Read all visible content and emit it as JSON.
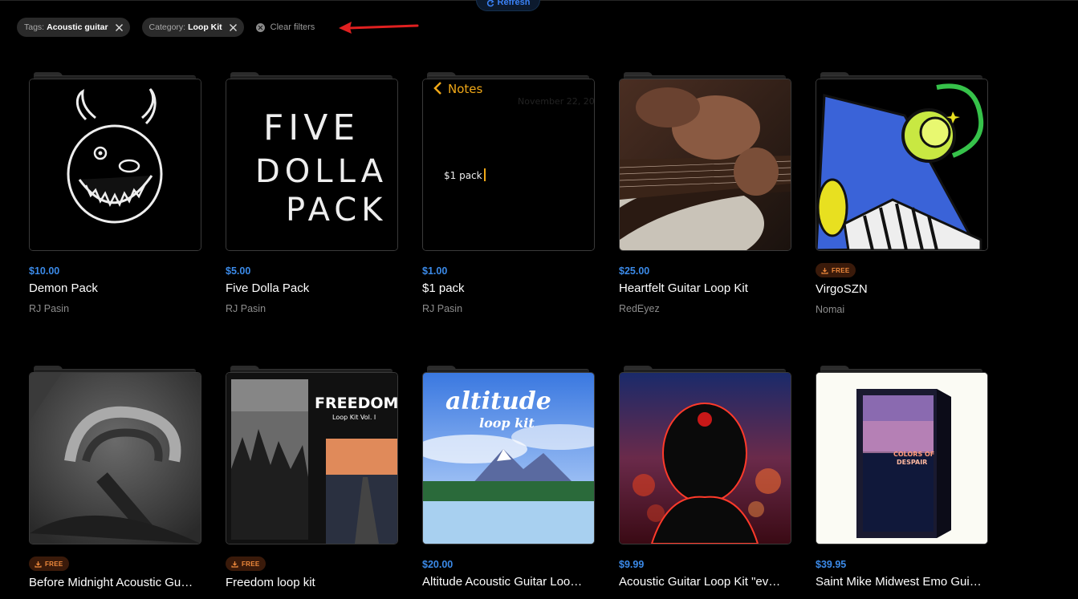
{
  "header": {
    "refresh_label": "Refresh"
  },
  "filters": {
    "chips": [
      {
        "key": "Tags:",
        "value": "Acoustic guitar"
      },
      {
        "key": "Category:",
        "value": "Loop Kit"
      }
    ],
    "clear_label": "Clear filters"
  },
  "products": [
    {
      "price": "$10.00",
      "title": "Demon Pack",
      "author": "RJ Pasin",
      "art": "demon"
    },
    {
      "price": "$5.00",
      "title": "Five Dolla Pack",
      "author": "RJ Pasin",
      "art": "five",
      "art_text": [
        "FIVE",
        "DOLLA",
        "PACK"
      ]
    },
    {
      "price": "$1.00",
      "title": "$1 pack",
      "author": "RJ Pasin",
      "art": "notes",
      "art_text": {
        "back": "Notes",
        "date": "November 22, 20",
        "body": "$1 pack"
      }
    },
    {
      "price": "$25.00",
      "title": "Heartfelt Guitar Loop Kit",
      "author": "RedEyez",
      "art": "guitar"
    },
    {
      "badge": "FREE",
      "title": "VirgoSZN",
      "author": "Nomai",
      "art": "rocket"
    },
    {
      "badge": "FREE",
      "title": "Before Midnight Acoustic Gu…",
      "author": "",
      "art": "gray"
    },
    {
      "badge": "FREE",
      "title": "Freedom loop kit",
      "author": "",
      "art": "freedom",
      "art_text": {
        "title": "FREEDOM",
        "sub": "Loop Kit Vol. I"
      }
    },
    {
      "price": "$20.00",
      "title": "Altitude Acoustic Guitar Loo…",
      "author": "",
      "art": "altitude",
      "art_text": {
        "title": "altitude",
        "sub": "loop kit"
      }
    },
    {
      "price": "$9.99",
      "title": "Acoustic Guitar Loop Kit \"ev…",
      "author": "",
      "art": "anime"
    },
    {
      "price": "$39.95",
      "title": "Saint Mike Midwest Emo Gui…",
      "author": "",
      "art": "box",
      "art_text": {
        "title": "COLORS OF",
        "sub": "DESPAIR"
      }
    }
  ],
  "colors": {
    "price": "#3b8ae8",
    "free_badge_bg": "#3a1a0a",
    "free_badge_text": "#f08a3c",
    "annotation_arrow": "#e02020"
  }
}
